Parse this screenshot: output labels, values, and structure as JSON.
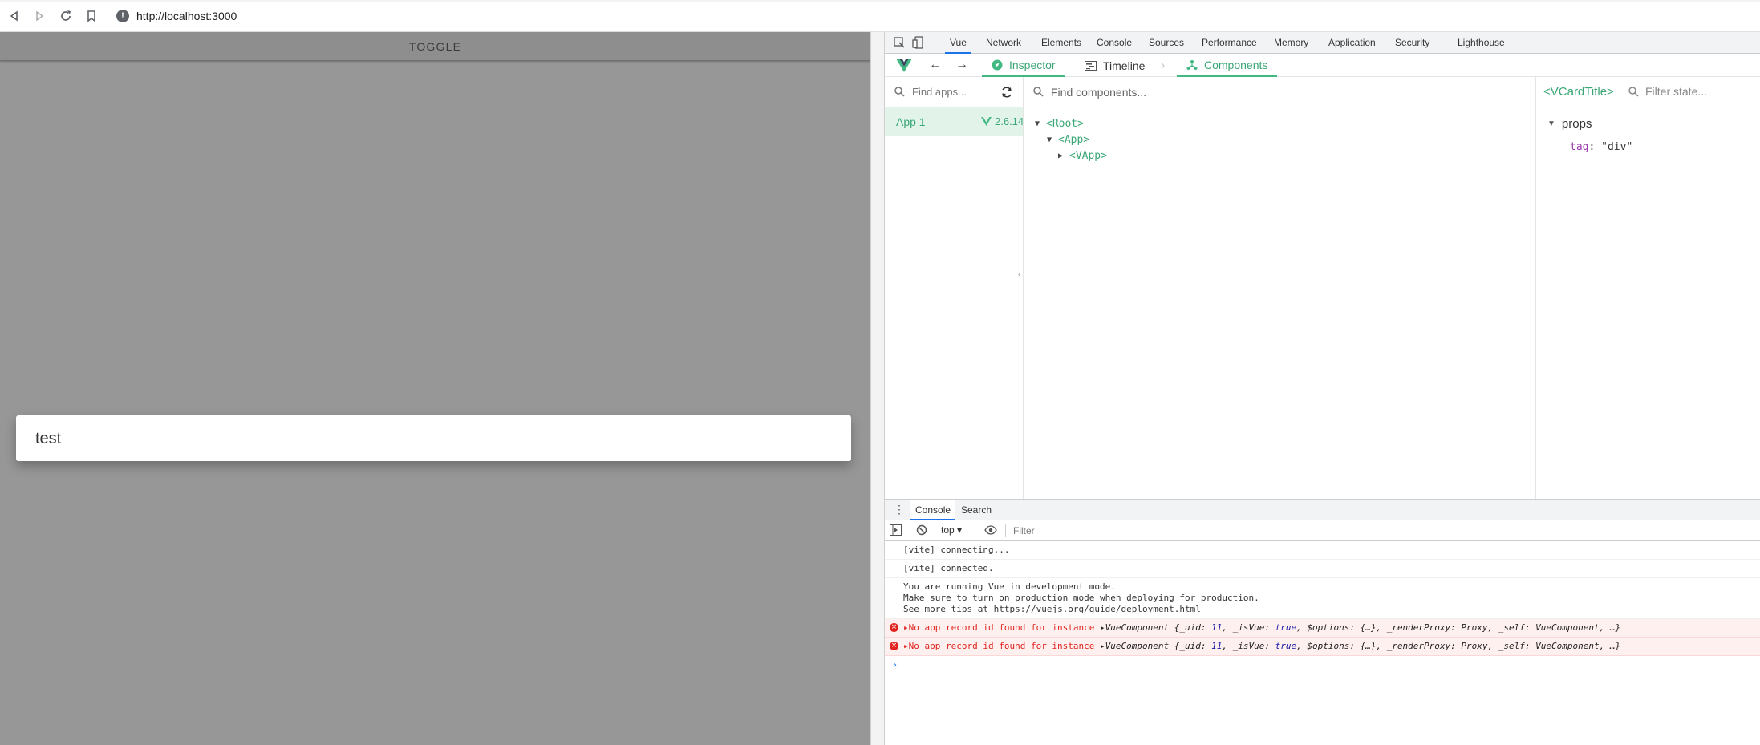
{
  "browser": {
    "url": "http://localhost:3000"
  },
  "app": {
    "toggle_label": "TOGGLE",
    "card_title": "test"
  },
  "devtools": {
    "tabs": [
      "Vue",
      "Network",
      "Elements",
      "Console",
      "Sources",
      "Performance",
      "Memory",
      "Application",
      "Security",
      "Lighthouse"
    ],
    "active_tab": "Vue",
    "vue_toolbar": {
      "inspector_label": "Inspector",
      "timeline_label": "Timeline",
      "components_label": "Components"
    },
    "apps": {
      "search_placeholder": "Find apps...",
      "items": [
        {
          "name": "App 1",
          "version": "2.6.14"
        }
      ]
    },
    "tree": {
      "search_placeholder": "Find components...",
      "nodes": [
        "<Root>",
        "<App>",
        "<VApp>"
      ]
    },
    "state": {
      "component": "<VCardTitle>",
      "filter_placeholder": "Filter state...",
      "section": "props",
      "prop_key": "tag",
      "prop_value": "\"div\""
    },
    "drawer": {
      "tabs": [
        "Console",
        "Search"
      ],
      "context": "top",
      "filter_placeholder": "Filter",
      "lines": {
        "l1": "[vite] connecting...",
        "l2": "[vite] connected.",
        "l3a": "You are running Vue in development mode.",
        "l3b": "Make sure to turn on production mode when deploying for production.",
        "l3c_prefix": "See more tips at ",
        "l3c_link": "https://vuejs.org/guide/deployment.html",
        "err_text": "No app record id found for instance",
        "err_obj_prefix": "VueComponent {_uid: ",
        "err_uid": "11",
        "err_mid1": ", _isVue: ",
        "err_true": "true",
        "err_mid2": ", $options: {…}, _renderProxy: Proxy, _self: VueComponent, …}"
      }
    }
  },
  "colors": {
    "vue_green": "#42b883",
    "overlay_gray": "#979797",
    "error_red": "#e0241f",
    "devtools_blue": "#1a73e8"
  }
}
